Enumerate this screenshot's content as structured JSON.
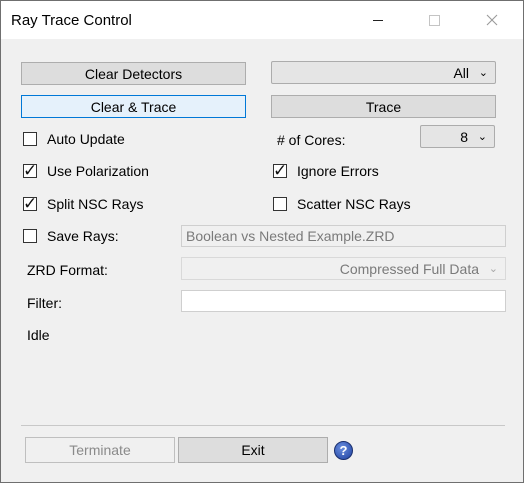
{
  "window": {
    "title": "Ray Trace Control"
  },
  "buttons": {
    "clear_detectors": "Clear Detectors",
    "clear_trace": "Clear & Trace",
    "trace": "Trace",
    "terminate": "Terminate",
    "exit": "Exit"
  },
  "detector_select": {
    "value": "All"
  },
  "cores": {
    "label": "# of Cores:",
    "value": "8"
  },
  "options": {
    "auto_update": {
      "label": "Auto Update",
      "checked": false
    },
    "use_polarization": {
      "label": "Use Polarization",
      "checked": true
    },
    "ignore_errors": {
      "label": "Ignore Errors",
      "checked": true
    },
    "split_nsc_rays": {
      "label": "Split NSC Rays",
      "checked": true
    },
    "scatter_nsc_rays": {
      "label": "Scatter NSC Rays",
      "checked": false
    },
    "save_rays": {
      "label": "Save Rays:",
      "checked": false
    }
  },
  "save_rays_file": {
    "value": "Boolean vs Nested Example.ZRD"
  },
  "zrd_format": {
    "label": "ZRD Format:",
    "value": "Compressed Full Data"
  },
  "filter": {
    "label": "Filter:",
    "value": ""
  },
  "status": {
    "text": "Idle"
  },
  "icons": {
    "help": "help-icon",
    "check": "checkmark-icon",
    "dropdown": "chevron-down-icon"
  }
}
